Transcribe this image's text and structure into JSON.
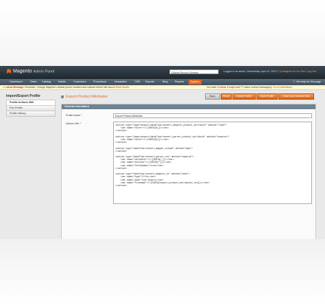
{
  "header": {
    "brand": "Magento",
    "panel": "Admin Panel",
    "search_value": "Global Record Search",
    "login_text": "Logged in as admin | Wednesday, April 22, 2015 |",
    "try_link": "Try Magento Go for Free",
    "logout": "| Log Out"
  },
  "nav": {
    "items": [
      "Dashboard",
      "Sales",
      "Catalog",
      "Mobile",
      "Customers",
      "Promotions",
      "Newsletter",
      "CMS",
      "Exports",
      "Blog",
      "Reports",
      "System"
    ],
    "active_index": 11,
    "help": "Get help for this page"
  },
  "message": {
    "label": "Latest Message:",
    "text": "Reminder: Change Magento's default phone numbers and callouts before site launch",
    "read_details": "Read details",
    "count_prefix": "You have",
    "critical": "3 critical",
    "major": "6 major",
    "rest": "and 77 notice unread message(s).",
    "go_link": "Go to notifications"
  },
  "sidebar": {
    "title": "Import/Export Profile",
    "tabs": [
      "Profile Actions XML",
      "Run Profile",
      "Profile History"
    ],
    "active_index": 0
  },
  "main": {
    "title": "Export Product Attributes",
    "buttons": {
      "back": "Back",
      "reset": "Reset",
      "delete": "Delete Profile",
      "save": "Save Profile",
      "save_continue": "Save and Continue Edit"
    },
    "section": "General Information",
    "profile_name_label": "Profile Name *",
    "profile_name_value": "Export Product Attributes",
    "actions_label": "Actions XML *",
    "xml_lines": [
      "<action type=\"importexport/dataflow/convert_adapter_product_attribute\" method=\"load\">",
      "    <var name=\"store\"><![CDATA[0]]></var>",
      "</action>",
      "",
      "<action type=\"importexport/dataflow/convert_parser_product_attribute\" method=\"unparse\">",
      "    <var name=\"store\"><![CDATA[0]]></var>",
      "</action>",
      "",
      "<action type=\"dataflow/convert_mapper_column\" method=\"map\">",
      "</action>",
      "",
      "<action type=\"dataflow/convert_parser_csv\" method=\"unparse\">",
      "    <var name=\"delimiter\"><![CDATA[,]]></var>",
      "    <var name=\"enclose\"><![CDATA[\"]]></var>",
      "    <var name=\"fieldnames\">true</var>",
      "</action>",
      "",
      "<action type=\"dataflow/convert_adapter_io\" method=\"save\">",
      "    <var name=\"type\">file</var>",
      "    <var name=\"path\">var/export</var>",
      "    <var name=\"filename\"><![CDATA[export_product_attributes.csv]]></var>",
      "</action>"
    ]
  }
}
